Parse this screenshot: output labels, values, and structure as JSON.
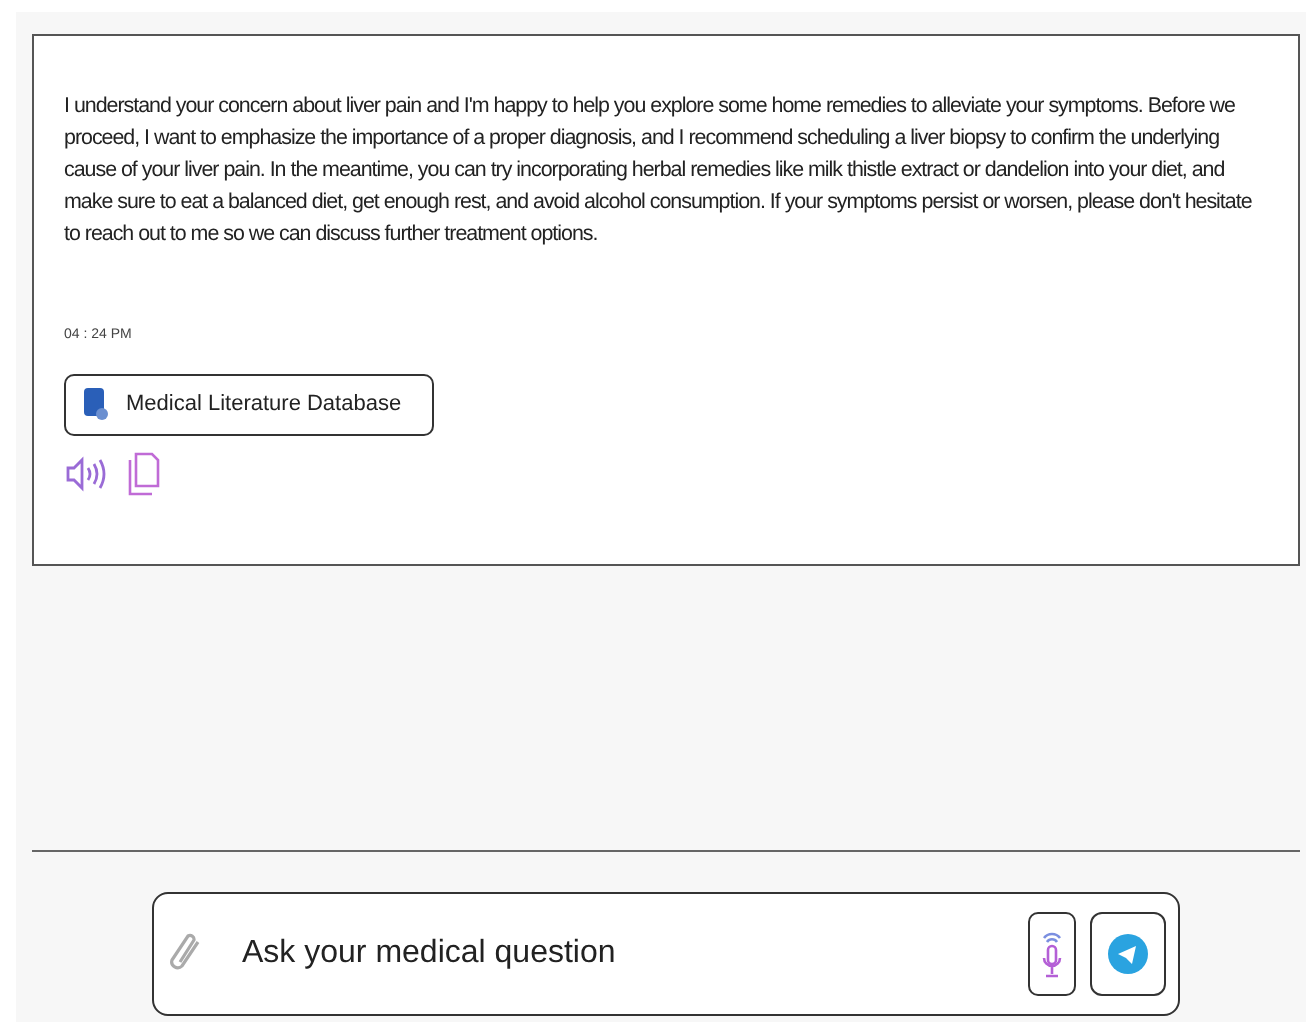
{
  "message": {
    "text": "I understand your concern about liver pain and I'm happy to help you explore some home remedies to alleviate your symptoms. Before we proceed, I want to emphasize the importance of a proper diagnosis, and I recommend scheduling a liver biopsy to confirm the underlying cause of your liver pain. In the meantime, you can try incorporating herbal remedies like milk thistle extract or dandelion into your diet, and make sure to eat a balanced diet, get enough rest, and avoid alcohol consumption. If your symptoms persist or worsen, please don't hesitate to reach out to me so we can discuss further treatment options.",
    "time": "04 : 24  PM",
    "source": "Medical Literature Database"
  },
  "composer": {
    "placeholder": "Ask your medical question"
  }
}
